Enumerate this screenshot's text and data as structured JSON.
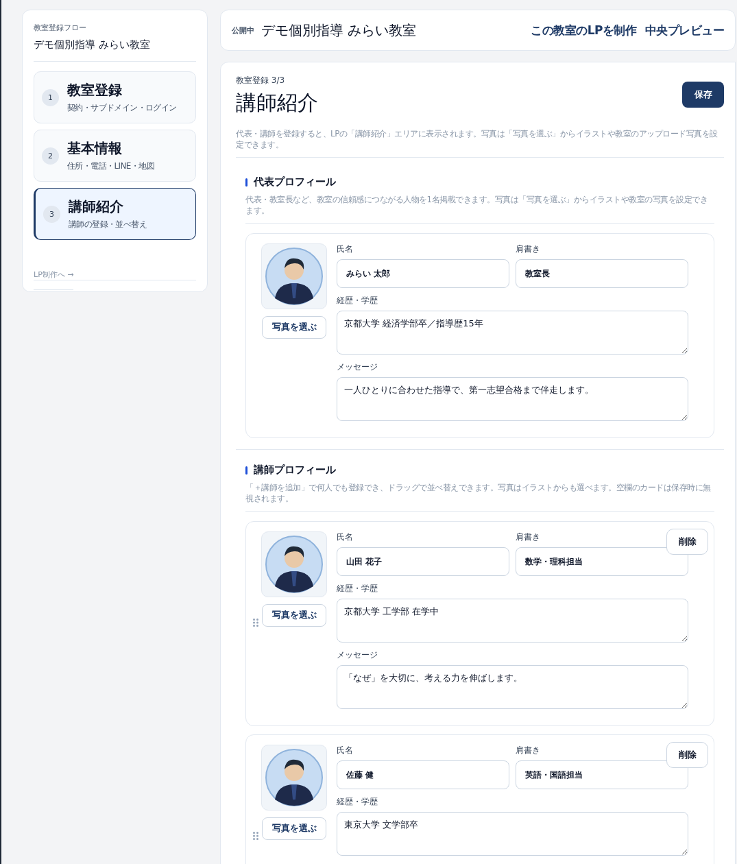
{
  "sidebar": {
    "flow_label": "教室登録フロー",
    "school_name": "デモ個別指導 みらい教室",
    "steps": [
      {
        "number": "1",
        "title": "教室登録",
        "subtitle": "契約・サブドメイン・ログイン",
        "selected": false
      },
      {
        "number": "2",
        "title": "基本情報",
        "subtitle": "住所・電話・LINE・地図",
        "selected": false
      },
      {
        "number": "3",
        "title": "講師紹介",
        "subtitle": "講師の登録・並べ替え",
        "selected": true
      }
    ],
    "next_link": {
      "label": "LP制作へ →",
      "disabled": true
    }
  },
  "header": {
    "status": "公開中",
    "school_name": "デモ個別指導 みらい教室",
    "actions": [
      "この教室のLPを制作",
      "中央プレビュー"
    ]
  },
  "main": {
    "step_label": "教室登録 3/3",
    "title": "講師紹介",
    "save_button": "保存",
    "description": "代表・講師を登録すると、LPの「講師紹介」エリアに表示されます。写真は「写真を選ぶ」からイラストや教室のアップロード写真を設定できます。",
    "sections": [
      {
        "heading": "代表プロフィール",
        "description": "代表・教室長など、教室の信頼感につながる人物を1名掲載できます。写真は「写真を選ぶ」からイラストや教室の写真を設定できます。",
        "cards": [
          {
            "kind": "representative",
            "photo_button": "写真を選ぶ",
            "name_label": "氏名",
            "name": "みらい 太郎",
            "title_label": "肩書き",
            "title": "教室長",
            "career_label": "経歴・学歴",
            "career": "京都大学 経済学部卒／指導歴15年",
            "message_label": "メッセージ",
            "message": "一人ひとりに合わせた指導で、第一志望合格まで伴走します。"
          }
        ]
      },
      {
        "heading": "講師プロフィール",
        "description": "「＋講師を追加」で何人でも登録でき、ドラッグで並べ替えできます。写真はイラストからも選べます。空欄のカードは保存時に無視されます。",
        "cards": [
          {
            "kind": "teacher",
            "photo_button": "写真を選ぶ",
            "delete_button": "削除",
            "name_label": "氏名",
            "name": "山田 花子",
            "title_label": "肩書き",
            "title": "数学・理科担当",
            "career_label": "経歴・学歴",
            "career": "京都大学 工学部 在学中",
            "message_label": "メッセージ",
            "message": "「なぜ」を大切に、考える力を伸ばします。"
          },
          {
            "kind": "teacher",
            "photo_button": "写真を選ぶ",
            "delete_button": "削除",
            "name_label": "氏名",
            "name": "佐藤 健",
            "title_label": "肩書き",
            "title": "英語・国語担当",
            "career_label": "経歴・学歴",
            "career": "東京大学 文学部卒"
          }
        ]
      }
    ]
  }
}
